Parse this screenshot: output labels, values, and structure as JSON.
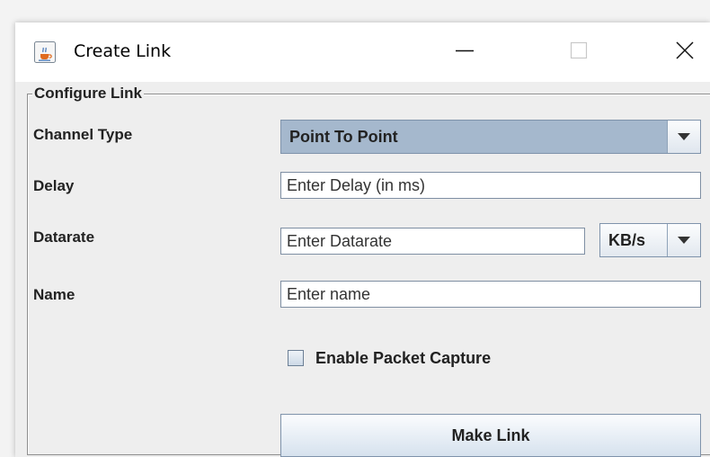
{
  "window": {
    "title": "Create Link"
  },
  "configure_link": {
    "group_title": "Configure Link",
    "channel_type": {
      "label": "Channel Type",
      "selected": "Point To Point"
    },
    "delay": {
      "label": "Delay",
      "placeholder": "Enter Delay (in ms)"
    },
    "datarate": {
      "label": "Datarate",
      "placeholder": "Enter Datarate",
      "unit_selected": "KB/s"
    },
    "name": {
      "label": "Name",
      "placeholder": "Enter name"
    },
    "packet_capture": {
      "label": "Enable Packet Capture",
      "checked": false
    },
    "make_link_label": "Make Link"
  },
  "colors": {
    "combo_selected_bg": "#a5b8cd",
    "button_gradient_bottom": "#d6e2ee",
    "panel_bg": "#eeeeee"
  },
  "icons": {
    "app": "java-coffee-cup-icon",
    "minimize": "minimize-icon",
    "maximize": "maximize-icon",
    "close": "close-icon",
    "dropdown": "chevron-down-icon"
  }
}
